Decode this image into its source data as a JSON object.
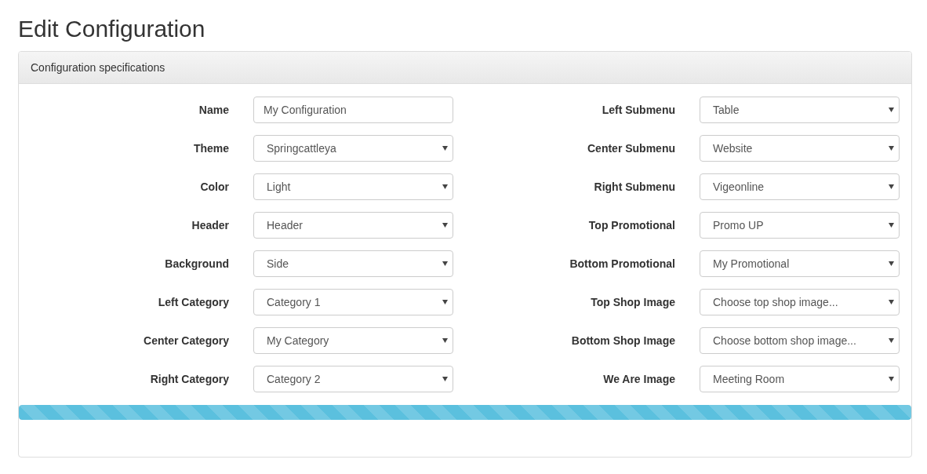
{
  "page_title": "Edit Configuration",
  "panel": {
    "heading": "Configuration specifications",
    "columns": [
      {
        "fields": [
          {
            "label": "Name",
            "kind": "text",
            "value": "My Configuration"
          },
          {
            "label": "Theme",
            "kind": "select",
            "value": "Springcattleya"
          },
          {
            "label": "Color",
            "kind": "select",
            "value": "Light"
          },
          {
            "label": "Header",
            "kind": "select",
            "value": "Header"
          },
          {
            "label": "Background",
            "kind": "select",
            "value": "Side"
          },
          {
            "label": "Left Category",
            "kind": "select",
            "value": "Category 1"
          },
          {
            "label": "Center Category",
            "kind": "select",
            "value": "My Category"
          },
          {
            "label": "Right Category",
            "kind": "select",
            "value": "Category 2"
          }
        ]
      },
      {
        "fields": [
          {
            "label": "Left Submenu",
            "kind": "select",
            "value": "Table"
          },
          {
            "label": "Center Submenu",
            "kind": "select",
            "value": "Website"
          },
          {
            "label": "Right Submenu",
            "kind": "select",
            "value": "Vigeonline"
          },
          {
            "label": "Top Promotional",
            "kind": "select",
            "value": "Promo UP"
          },
          {
            "label": "Bottom Promotional",
            "kind": "select",
            "value": "My Promotional"
          },
          {
            "label": "Top Shop Image",
            "kind": "select",
            "value": "Choose top shop image..."
          },
          {
            "label": "Bottom Shop Image",
            "kind": "select",
            "value": "Choose bottom shop image..."
          },
          {
            "label": "We Are Image",
            "kind": "select",
            "value": "Meeting Room"
          }
        ]
      }
    ],
    "progress": {
      "level": 1
    }
  }
}
